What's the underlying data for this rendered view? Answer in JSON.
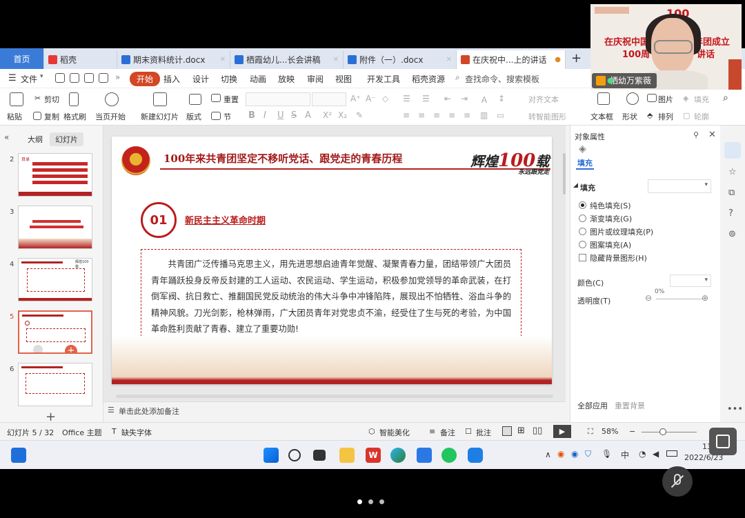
{
  "tabs": [
    {
      "label": "首页"
    },
    {
      "label": "稻壳"
    },
    {
      "label": "期末资料统计.docx"
    },
    {
      "label": "栖霞幼儿...长会讲稿"
    },
    {
      "label": "附件（一）.docx"
    },
    {
      "label": "在庆祝中...上的讲话"
    }
  ],
  "menu": {
    "file": "文件",
    "items": [
      "开始",
      "插入",
      "设计",
      "切换",
      "动画",
      "放映",
      "审阅",
      "视图",
      "开发工具",
      "稻壳资源"
    ],
    "search_placeholder": "查找命令、搜索模板"
  },
  "ribbon": {
    "paste": "粘贴",
    "cut": "剪切",
    "copy": "复制",
    "format_painter": "格式刷",
    "from_current": "当页开始",
    "new_slide": "新建幻灯片",
    "layout": "版式",
    "section": "节",
    "reset": "重置",
    "align_text": "对齐文本",
    "smart_shape": "转智能图形",
    "textbox": "文本框",
    "shape": "形状",
    "picture": "图片",
    "arrange": "排列",
    "fill": "填充",
    "outline": "轮廓"
  },
  "left_panel": {
    "tab_outline": "大纲",
    "tab_slides": "幻灯片",
    "slide_numbers": [
      "2",
      "3",
      "4",
      "5",
      "6"
    ],
    "thumb2_label": "目录",
    "thumb4_label": "辉煌100载"
  },
  "slide": {
    "title": "100年来共青团坚定不移听党话、跟党走的青春历程",
    "deco_main": "辉煌",
    "deco_num": "100",
    "deco_suffix": "载",
    "deco_sub": "永远跟党走",
    "section_number": "01",
    "section_title": "新民主主义革命时期",
    "body": "共青团广泛传播马克思主义，用先进思想启迪青年觉醒、凝聚青春力量，团结带领广大团员青年踊跃投身反帝反封建的工人运动、农民运动、学生运动，积极参加党领导的革命武装，在打倒军阀、抗日救亡、推翻国民党反动统治的伟大斗争中冲锋陷阵，展现出不怕牺牲、浴血斗争的精神风貌。刀光剑影，枪林弹雨，广大团员青年对党忠贞不渝，经受住了生与死的考验，为中国革命胜利贡献了青春、建立了重要功勋!"
  },
  "notes_placeholder": "单击此处添加备注",
  "right_panel": {
    "header": "对象属性",
    "tab_fill": "填充",
    "section_fill": "填充",
    "opt_solid": "纯色填充(S)",
    "opt_gradient": "渐变填充(G)",
    "opt_picture": "图片或纹理填充(P)",
    "opt_pattern": "图案填充(A)",
    "opt_hide_bg": "隐藏背景图形(H)",
    "color_label": "颜色(C)",
    "transparency_label": "透明度(T)",
    "transparency_value": "0%",
    "apply_all": "全部应用",
    "reset_bg": "重置背景"
  },
  "status": {
    "slide_pos": "幻灯片 5 / 32",
    "theme": "Office 主题",
    "missing_font": "缺失字体",
    "smart_beautify": "智能美化",
    "notes": "备注",
    "comments": "批注",
    "zoom": "58%"
  },
  "taskbar": {
    "time": "13:4",
    "date": "2022/6/23",
    "ime": "中"
  },
  "webcam": {
    "line1": "在庆祝中国",
    "line1b": "年团成立",
    "line2": "100周",
    "line2b": "讲话",
    "name": "栖幼万紫薇",
    "top_num": "100"
  },
  "colors": {
    "accent_red": "#b91c1c",
    "tab_blue": "#3b7bd8",
    "kaishi_orange": "#d24726"
  }
}
